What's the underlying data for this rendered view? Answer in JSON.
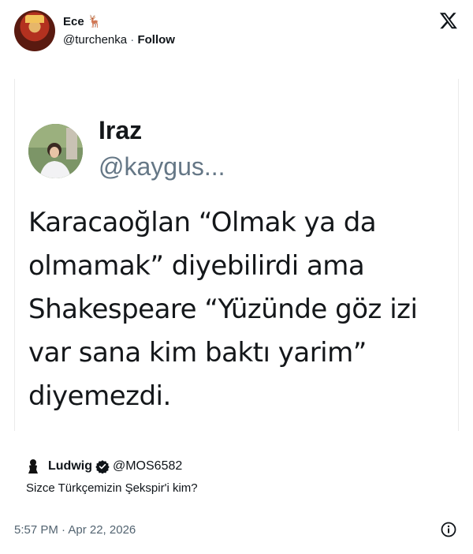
{
  "author": {
    "name": "Ece 🦌",
    "handle": "@turchenka",
    "separator": "·",
    "follow_label": "Follow"
  },
  "quoted": {
    "name": "Iraz",
    "handle": "@kaygus...",
    "text": "Karacaoğlan “Olmak ya da olmamak” diyebilirdi ama Shakespeare “Yüzünde göz izi var sana kim baktı yarim” diyemezdi."
  },
  "source": {
    "name": "Ludwig",
    "handle": "@MOS6582",
    "text": "Sizce Türkçemizin Şekspir'i kim?",
    "icon": "bust-icon",
    "verified_icon": "verified-badge-icon"
  },
  "footer": {
    "timestamp": "5:57 PM · Apr 22, 2026"
  },
  "icons": {
    "logo": "x-logo-icon",
    "info": "info-icon"
  },
  "colors": {
    "text": "#0f1419",
    "muted": "#536471",
    "quoted_handle": "#657786"
  }
}
